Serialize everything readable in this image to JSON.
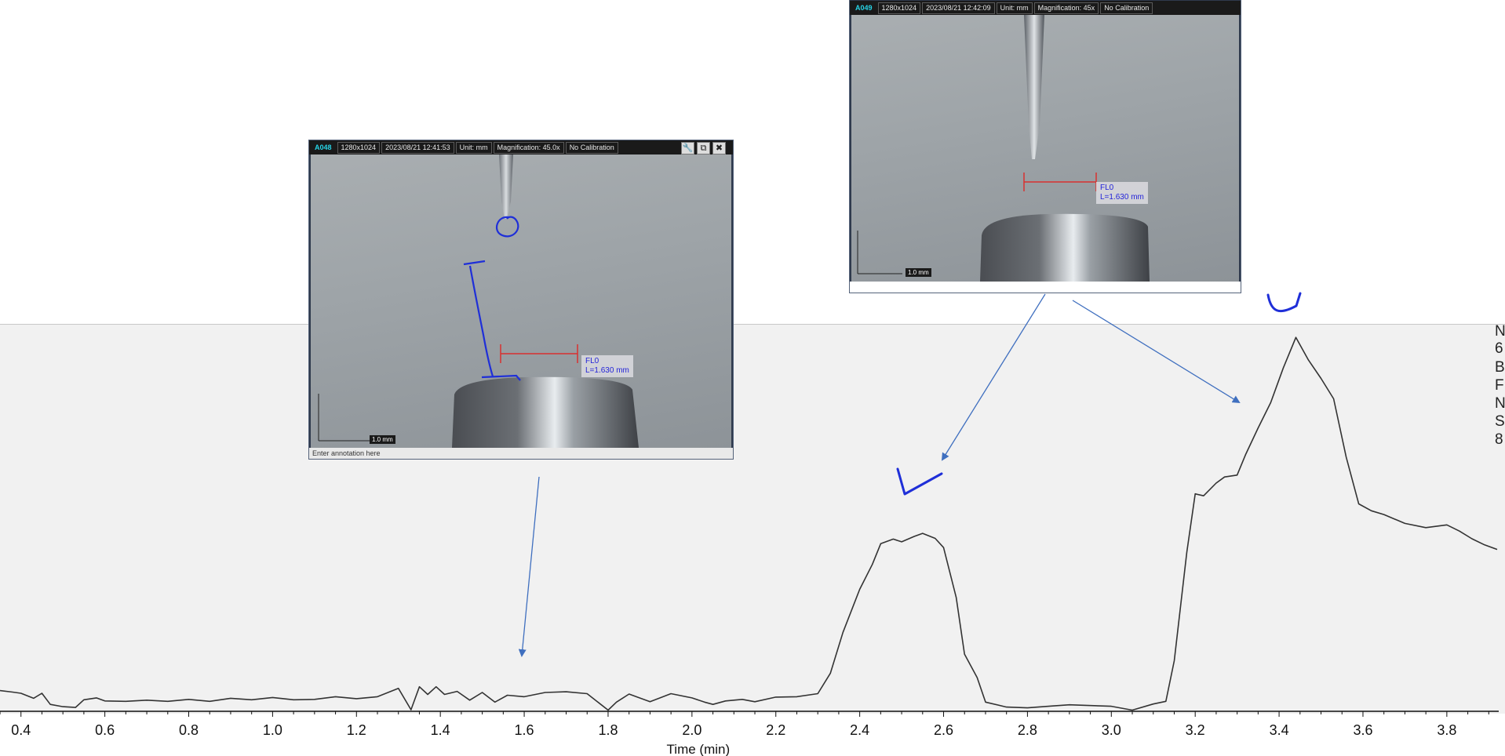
{
  "chart_data": {
    "type": "line",
    "xlabel": "Time (min)",
    "xlim": [
      0.35,
      3.92
    ],
    "ylim": [
      0,
      100
    ],
    "x_ticks": [
      "0.4",
      "0.6",
      "0.8",
      "1.0",
      "1.2",
      "1.4",
      "1.6",
      "1.8",
      "2.0",
      "2.2",
      "2.4",
      "2.6",
      "2.8",
      "3.0",
      "3.2",
      "3.4",
      "3.6",
      "3.8"
    ],
    "grid": false,
    "series": [
      {
        "x": [
          0.35,
          0.38,
          0.4,
          0.43,
          0.45,
          0.47,
          0.5,
          0.53,
          0.55,
          0.58,
          0.6,
          0.65,
          0.7,
          0.75,
          0.8,
          0.85,
          0.9,
          0.95,
          1.0,
          1.05,
          1.1,
          1.15,
          1.2,
          1.25,
          1.3,
          1.33,
          1.35,
          1.37,
          1.39,
          1.41,
          1.44,
          1.47,
          1.5,
          1.53,
          1.56,
          1.6,
          1.65,
          1.7,
          1.75,
          1.8,
          1.82,
          1.85,
          1.9,
          1.95,
          2.0,
          2.03,
          2.05,
          2.08,
          2.12,
          2.15,
          2.2,
          2.25,
          2.3,
          2.33,
          2.36,
          2.4,
          2.43,
          2.45,
          2.48,
          2.5,
          2.53,
          2.55,
          2.58,
          2.6,
          2.63,
          2.65,
          2.68,
          2.7,
          2.75,
          2.8,
          2.86,
          2.9,
          3.0,
          3.05,
          3.1,
          3.13,
          3.15,
          3.18,
          3.2,
          3.22,
          3.25,
          3.27,
          3.3,
          3.32,
          3.35,
          3.38,
          3.41,
          3.44,
          3.47,
          3.5,
          3.53,
          3.56,
          3.59,
          3.62,
          3.65,
          3.7,
          3.75,
          3.8,
          3.83,
          3.86,
          3.89,
          3.92
        ],
        "y": [
          5.4,
          5.0,
          4.7,
          3.4,
          4.7,
          1.8,
          1.2,
          1.0,
          3.0,
          3.5,
          2.7,
          2.6,
          2.9,
          2.6,
          3.1,
          2.6,
          3.4,
          3.0,
          3.6,
          3.0,
          3.1,
          3.8,
          3.3,
          3.8,
          6.0,
          0.4,
          6.4,
          4.4,
          6.4,
          4.4,
          5.2,
          2.9,
          4.9,
          2.4,
          4.2,
          3.8,
          4.9,
          5.1,
          4.6,
          0.3,
          2.4,
          4.5,
          2.5,
          4.6,
          3.5,
          2.4,
          1.8,
          2.7,
          3.1,
          2.5,
          3.7,
          3.8,
          4.6,
          9.9,
          20.6,
          31.8,
          38.3,
          43.7,
          44.9,
          44.2,
          45.6,
          46.4,
          45.1,
          42.7,
          29.7,
          14.9,
          8.8,
          2.4,
          1.1,
          0.9,
          1.4,
          1.7,
          1.3,
          0.3,
          1.9,
          2.6,
          13.2,
          41.5,
          56.7,
          56.2,
          59.5,
          61.1,
          61.6,
          66.9,
          73.9,
          80.5,
          89.5,
          97.5,
          91.6,
          86.8,
          81.5,
          66.3,
          54.1,
          52.3,
          51.3,
          49.0,
          47.9,
          48.6,
          47.0,
          45.0,
          43.4,
          42.2
        ]
      }
    ]
  },
  "side_text": [
    "N",
    "6",
    "B",
    "F",
    "N",
    "S",
    "8"
  ],
  "micro_a": {
    "id": "A048",
    "res": "1280x1024",
    "datetime": "2023/08/21 12:41:53",
    "unit": "Unit: mm",
    "mag": "Magnification: 45.0x",
    "calib": "No Calibration",
    "fl_name": "FL0",
    "fl_len": "L=1.630 mm",
    "scale": "1.0 mm",
    "annotation": "Enter annotation here",
    "ctrl_tool": "🔧",
    "ctrl_save": "⧉",
    "ctrl_close": "✖"
  },
  "micro_b": {
    "id": "A049",
    "res": "1280x1024",
    "datetime": "2023/08/21 12:42:09",
    "unit": "Unit: mm",
    "mag": "Magnification: 45x",
    "calib": "No Calibration",
    "fl_name": "FL0",
    "fl_len": "L=1.630 mm",
    "scale": "1.0 mm"
  },
  "colors": {
    "trace": "#333333",
    "annotation_blue": "#1f2fd8",
    "arrow": "#3f6fbf",
    "measure_red": "#d83030"
  }
}
